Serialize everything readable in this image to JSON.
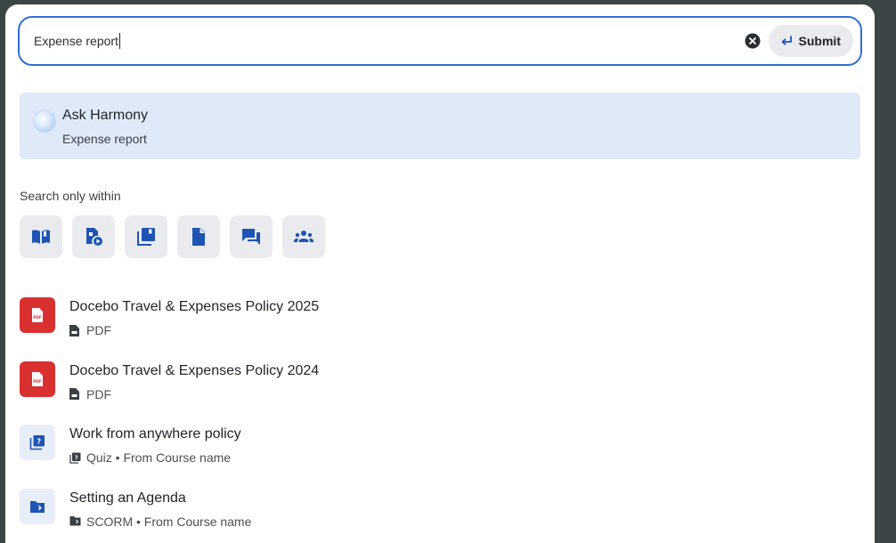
{
  "search": {
    "value": "Expense report",
    "submit_label": "Submit"
  },
  "ask": {
    "title": "Ask Harmony",
    "subtitle": "Expense report"
  },
  "filter": {
    "label": "Search only within",
    "items": [
      {
        "icon": "book-open-icon"
      },
      {
        "icon": "video-document-icon"
      },
      {
        "icon": "library-icon"
      },
      {
        "icon": "file-icon"
      },
      {
        "icon": "chat-bubbles-icon"
      },
      {
        "icon": "people-group-icon"
      }
    ]
  },
  "results": [
    {
      "title": "Docebo Travel & Expenses Policy 2025",
      "meta": "PDF",
      "type": "pdf"
    },
    {
      "title": "Docebo Travel & Expenses Policy 2024",
      "meta": "PDF",
      "type": "pdf"
    },
    {
      "title": "Work from anywhere policy",
      "meta": "Quiz • From Course name",
      "type": "quiz"
    },
    {
      "title": "Setting an Agenda",
      "meta": "SCORM • From Course name",
      "type": "scorm"
    }
  ],
  "colors": {
    "accent": "#2f6fd1",
    "icon_blue": "#1f54b5",
    "pdf_red": "#d8312f",
    "ask_bg": "#dfeaf8"
  }
}
